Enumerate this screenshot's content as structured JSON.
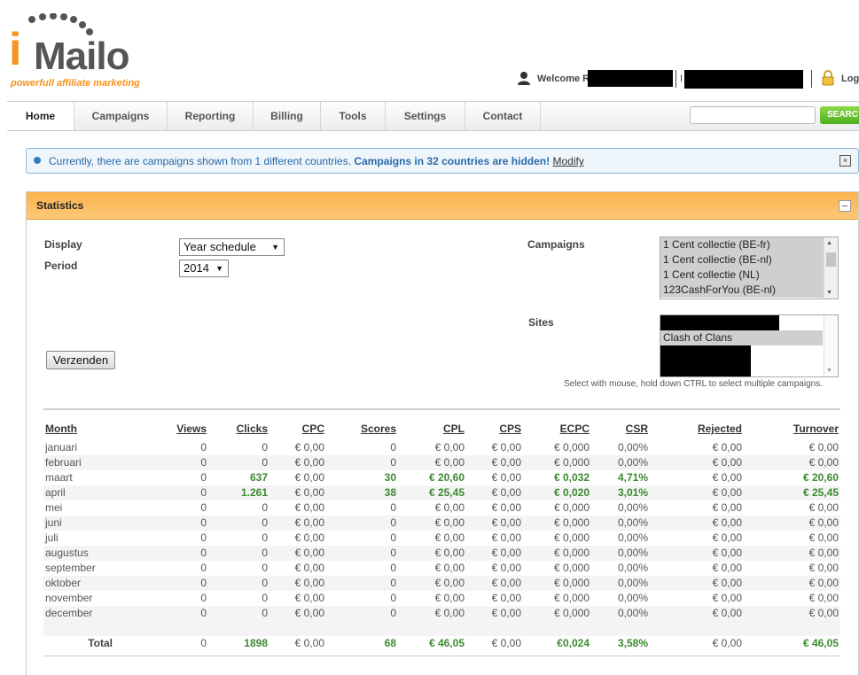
{
  "header": {
    "logo_i": "i",
    "logo_rest": "Mailo",
    "tagline": "powerfull affiliate marketing",
    "welcome": "Welcome R",
    "logout": "Log"
  },
  "nav": {
    "items": [
      "Home",
      "Campaigns",
      "Reporting",
      "Billing",
      "Tools",
      "Settings",
      "Contact"
    ],
    "search_button": "SEARC"
  },
  "info": {
    "text": "Currently, there are campaigns shown from 1 different countries.",
    "bold": "Campaigns in 32 countries are hidden!",
    "link": "Modify"
  },
  "panel": {
    "title": "Statistics",
    "display_label": "Display",
    "display_value": "Year schedule",
    "period_label": "Period",
    "period_value": "2014",
    "campaigns_label": "Campaigns",
    "campaigns": [
      "1 Cent collectie (BE-fr)",
      "1 Cent collectie (BE-nl)",
      "1 Cent collectie (NL)",
      "123CashForYou (BE-nl)"
    ],
    "sites_label": "Sites",
    "sites_visible": "Clash of Clans",
    "submit": "Verzenden",
    "hint": "Select with mouse, hold down CTRL to select multiple campaigns."
  },
  "table": {
    "headers": [
      "Month",
      "Views",
      "Clicks",
      "CPC",
      "Scores",
      "CPL",
      "CPS",
      "ECPC",
      "CSR",
      "Rejected",
      "Turnover"
    ],
    "rows": [
      [
        "januari",
        "0",
        "0",
        "€ 0,00",
        "0",
        "€ 0,00",
        "€ 0,00",
        "€ 0,000",
        "0,00%",
        "€ 0,00",
        "€ 0,00"
      ],
      [
        "februari",
        "0",
        "0",
        "€ 0,00",
        "0",
        "€ 0,00",
        "€ 0,00",
        "€ 0,000",
        "0,00%",
        "€ 0,00",
        "€ 0,00"
      ],
      [
        "maart",
        "0",
        "637",
        "€ 0,00",
        "30",
        "€ 20,60",
        "€ 0,00",
        "€ 0,032",
        "4,71%",
        "€ 0,00",
        "€ 20,60"
      ],
      [
        "april",
        "0",
        "1.261",
        "€ 0,00",
        "38",
        "€ 25,45",
        "€ 0,00",
        "€ 0,020",
        "3,01%",
        "€ 0,00",
        "€ 25,45"
      ],
      [
        "mei",
        "0",
        "0",
        "€ 0,00",
        "0",
        "€ 0,00",
        "€ 0,00",
        "€ 0,000",
        "0,00%",
        "€ 0,00",
        "€ 0,00"
      ],
      [
        "juni",
        "0",
        "0",
        "€ 0,00",
        "0",
        "€ 0,00",
        "€ 0,00",
        "€ 0,000",
        "0,00%",
        "€ 0,00",
        "€ 0,00"
      ],
      [
        "juli",
        "0",
        "0",
        "€ 0,00",
        "0",
        "€ 0,00",
        "€ 0,00",
        "€ 0,000",
        "0,00%",
        "€ 0,00",
        "€ 0,00"
      ],
      [
        "augustus",
        "0",
        "0",
        "€ 0,00",
        "0",
        "€ 0,00",
        "€ 0,00",
        "€ 0,000",
        "0,00%",
        "€ 0,00",
        "€ 0,00"
      ],
      [
        "september",
        "0",
        "0",
        "€ 0,00",
        "0",
        "€ 0,00",
        "€ 0,00",
        "€ 0,000",
        "0,00%",
        "€ 0,00",
        "€ 0,00"
      ],
      [
        "oktober",
        "0",
        "0",
        "€ 0,00",
        "0",
        "€ 0,00",
        "€ 0,00",
        "€ 0,000",
        "0,00%",
        "€ 0,00",
        "€ 0,00"
      ],
      [
        "november",
        "0",
        "0",
        "€ 0,00",
        "0",
        "€ 0,00",
        "€ 0,00",
        "€ 0,000",
        "0,00%",
        "€ 0,00",
        "€ 0,00"
      ],
      [
        "december",
        "0",
        "0",
        "€ 0,00",
        "0",
        "€ 0,00",
        "€ 0,00",
        "€ 0,000",
        "0,00%",
        "€ 0,00",
        "€ 0,00"
      ]
    ],
    "total": [
      "Total",
      "0",
      "1898",
      "€ 0,00",
      "68",
      "€ 46,05",
      "€ 0,00",
      "€0,024",
      "3,58%",
      "€ 0,00",
      "€ 46,05"
    ],
    "highlight_color": "#3a8a2e"
  }
}
